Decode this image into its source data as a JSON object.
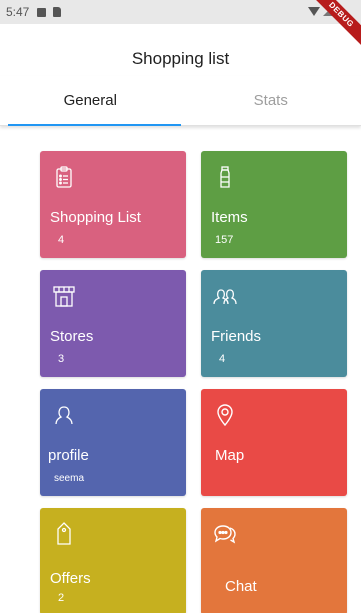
{
  "status_bar": {
    "time": "5:47",
    "debug_label": "DEBUG"
  },
  "app_bar": {
    "title": "Shopping list"
  },
  "tabs": [
    {
      "label": "General",
      "active": true
    },
    {
      "label": "Stats",
      "active": false
    }
  ],
  "tiles": [
    {
      "label": "Shopping List",
      "count": "4",
      "color": "#d9617f",
      "icon": "clipboard-list-icon"
    },
    {
      "label": "Items",
      "count": "157",
      "color": "#5e9e44",
      "icon": "bottle-icon"
    },
    {
      "label": "Stores",
      "count": "3",
      "color": "#7d5aae",
      "icon": "store-icon"
    },
    {
      "label": "Friends",
      "count": "4",
      "color": "#4b8c9c",
      "icon": "people-icon"
    },
    {
      "label": "profile",
      "sub": "seema",
      "color": "#5465ae",
      "icon": "person-icon"
    },
    {
      "label": "Map",
      "color": "#e94a46",
      "icon": "map-pin-icon"
    },
    {
      "label": "Offers",
      "count": "2",
      "color": "#c6b01f",
      "icon": "tag-icon"
    },
    {
      "label": "Chat",
      "color": "#e3763c",
      "icon": "chat-bubbles-icon"
    }
  ]
}
